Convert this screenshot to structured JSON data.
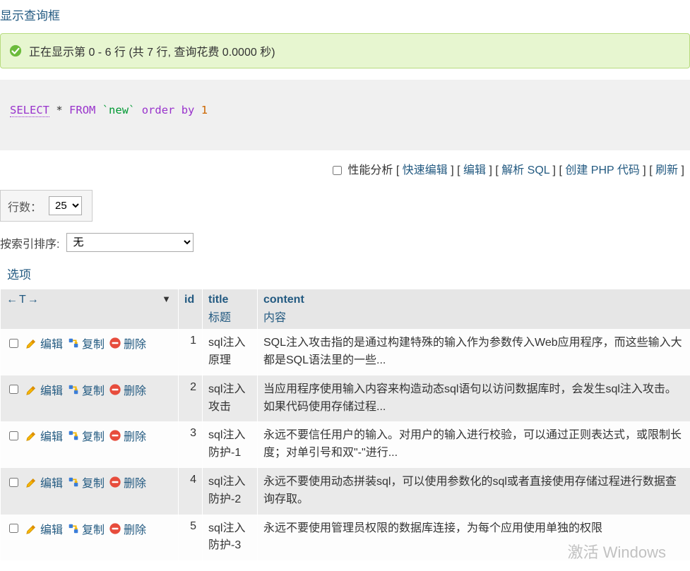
{
  "topLink": "显示查询框",
  "successMsg": "正在显示第 0 - 6 行 (共 7 行, 查询花费 0.0000 秒)",
  "sql": {
    "select": "SELECT",
    "star": "*",
    "from": "FROM",
    "table": "`new`",
    "orderby": "order by",
    "ord": "1"
  },
  "toolbar": {
    "perf": "性能分析",
    "quickEdit": "快速编辑",
    "edit": "编辑",
    "parse": "解析 SQL",
    "createPhp": "创建 PHP 代码",
    "refresh": "刷新"
  },
  "rows": {
    "label": "行数：",
    "value": "25"
  },
  "sort": {
    "label": "按索引排序:",
    "value": "无"
  },
  "optionsLabel": "选项",
  "headers": {
    "arrows": "←T→",
    "id": "id",
    "title": "title",
    "titleSub": "标题",
    "content": "content",
    "contentSub": "内容"
  },
  "actions": {
    "edit": "编辑",
    "copy": "复制",
    "delete": "删除"
  },
  "data": [
    {
      "id": "1",
      "title": "sql注入原理",
      "content": "SQL注入攻击指的是通过构建特殊的输入作为参数传入Web应用程序，而这些输入大都是SQL语法里的一些..."
    },
    {
      "id": "2",
      "title": "sql注入攻击",
      "content": "当应用程序使用输入内容来构造动态sql语句以访问数据库时，会发生sql注入攻击。如果代码使用存储过程..."
    },
    {
      "id": "3",
      "title": "sql注入防护-1",
      "content": "永远不要信任用户的输入。对用户的输入进行校验，可以通过正则表达式，或限制长度；对单引号和双\"-\"进行..."
    },
    {
      "id": "4",
      "title": "sql注入防护-2",
      "content": "永远不要使用动态拼装sql，可以使用参数化的sql或者直接使用存储过程进行数据查询存取。"
    },
    {
      "id": "5",
      "title": "sql注入防护-3",
      "content": "永远不要使用管理员权限的数据库连接，为每个应用使用单独的权限"
    }
  ],
  "watermark": "激活 Windows"
}
